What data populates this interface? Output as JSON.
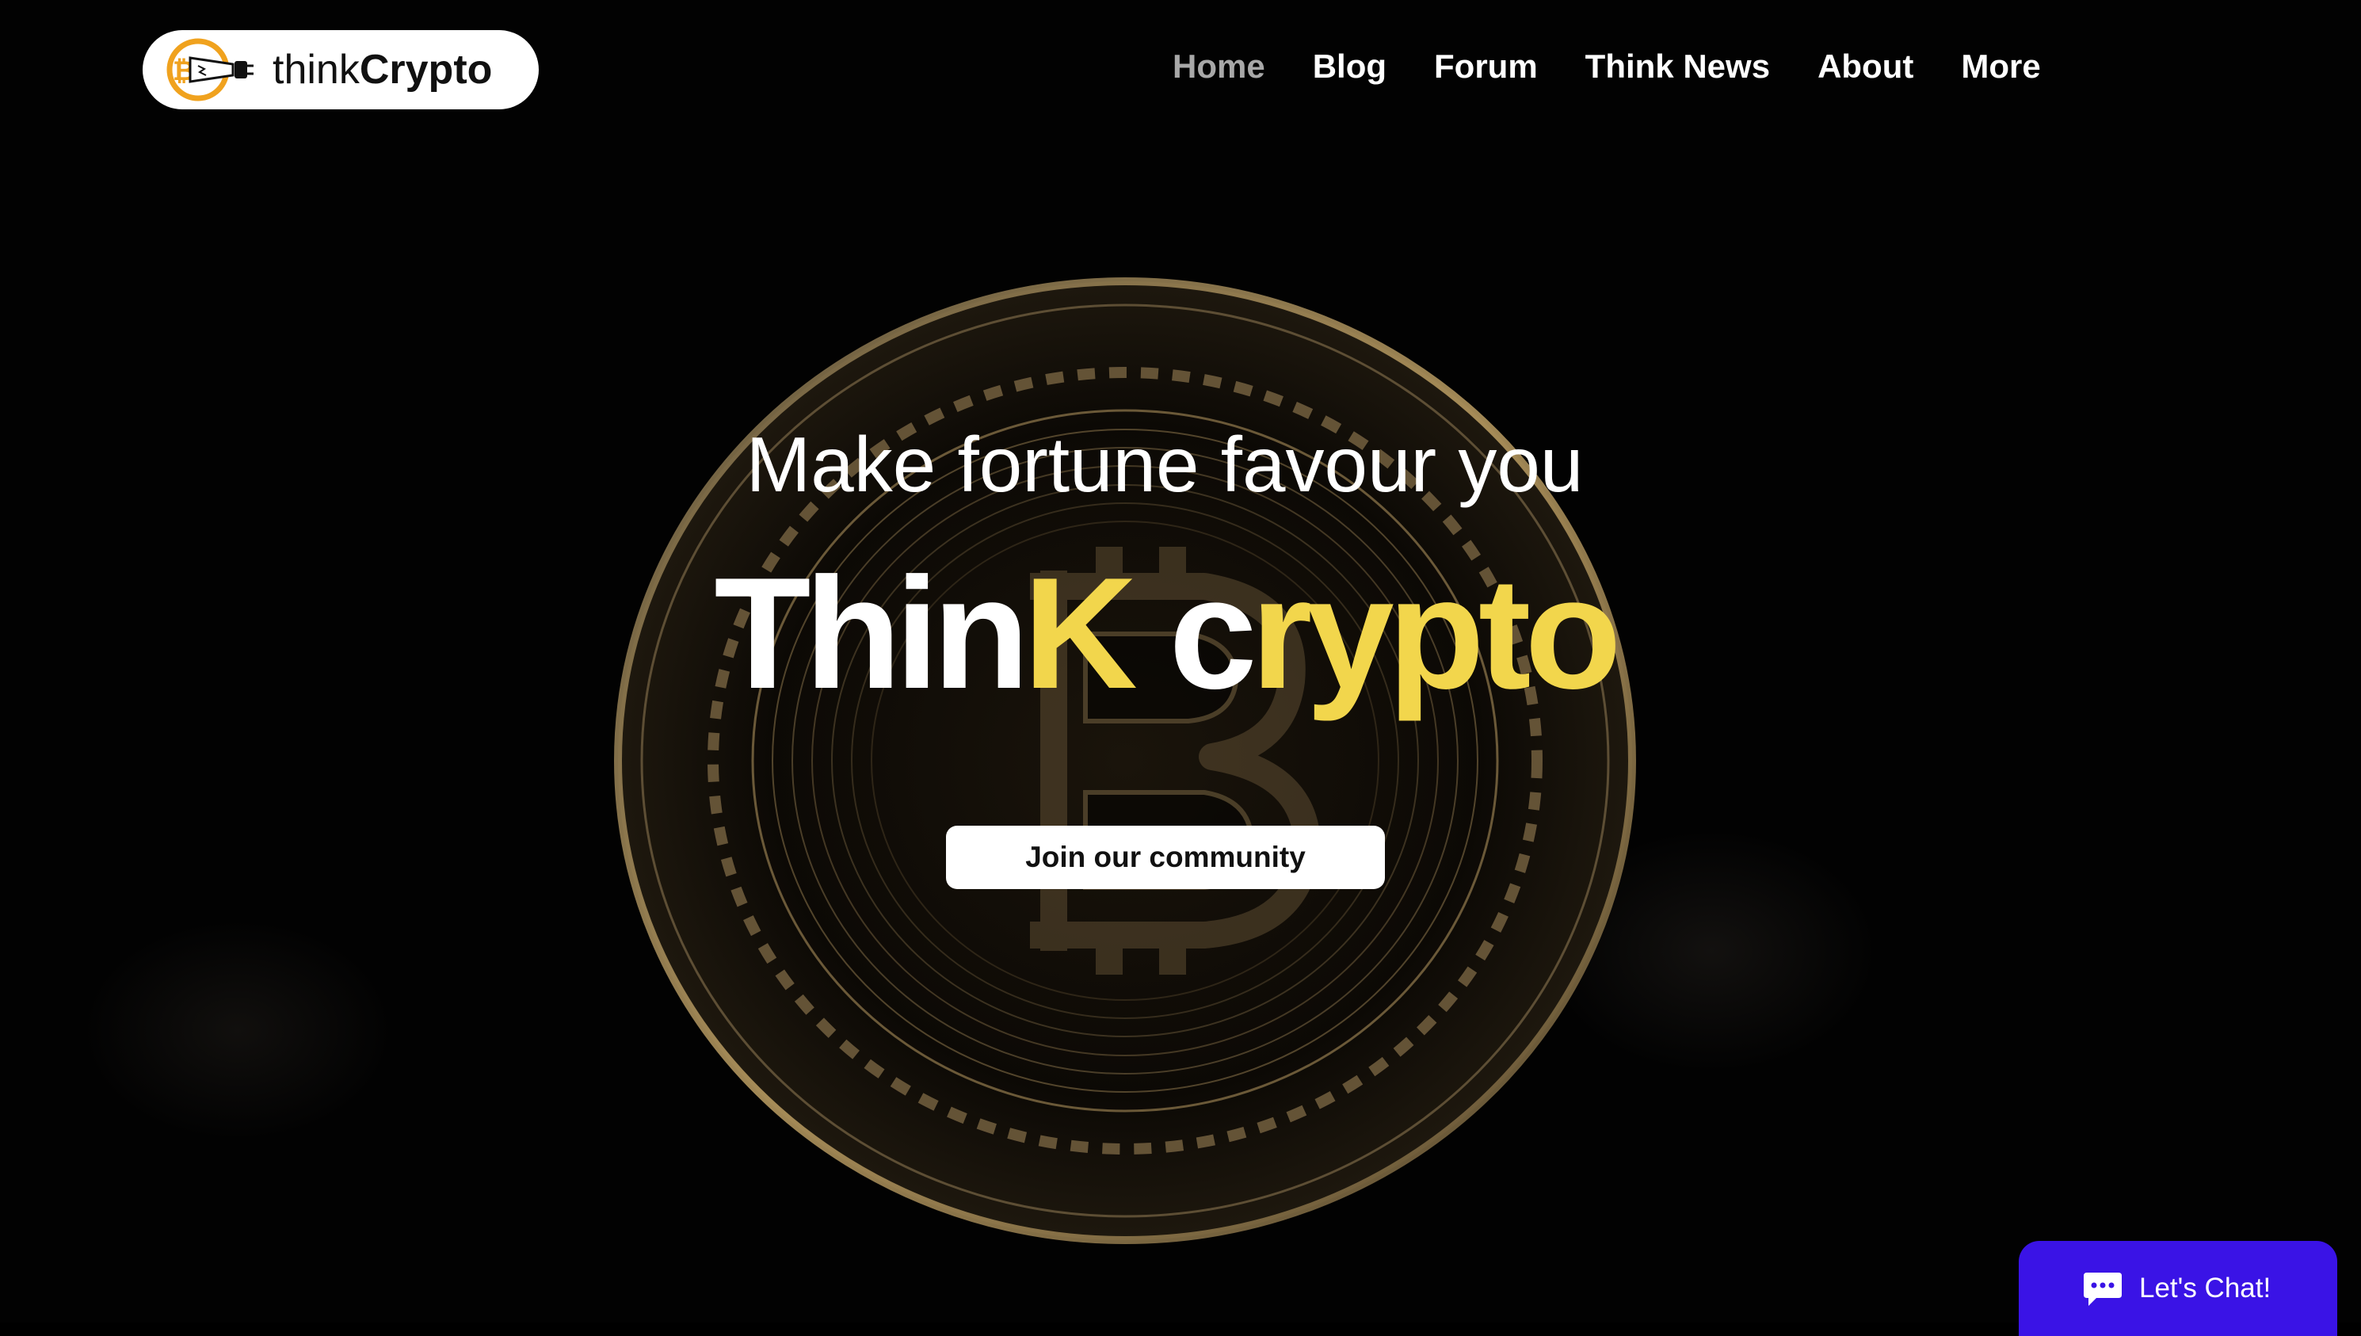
{
  "brand": {
    "logo_think": "think",
    "logo_crypto": "Crypto",
    "accent_yellow": "#f2d64c",
    "logo_orange": "#f0a21e"
  },
  "nav": {
    "items": [
      {
        "label": "Home",
        "active": true
      },
      {
        "label": "Blog",
        "active": false
      },
      {
        "label": "Forum",
        "active": false
      },
      {
        "label": "Think News",
        "active": false
      },
      {
        "label": "About",
        "active": false
      },
      {
        "label": "More",
        "active": false
      }
    ]
  },
  "hero": {
    "tagline": "Make fortune favour you",
    "headline_part1": "Thin",
    "headline_part2": "K ",
    "headline_part3": "c",
    "headline_part4": "rypto",
    "cta_label": "Join our community",
    "background_icon": "bitcoin-coin-icon"
  },
  "chat": {
    "label": "Let's Chat!",
    "icon": "chat-bubble-icon",
    "color": "#3a13e6"
  }
}
